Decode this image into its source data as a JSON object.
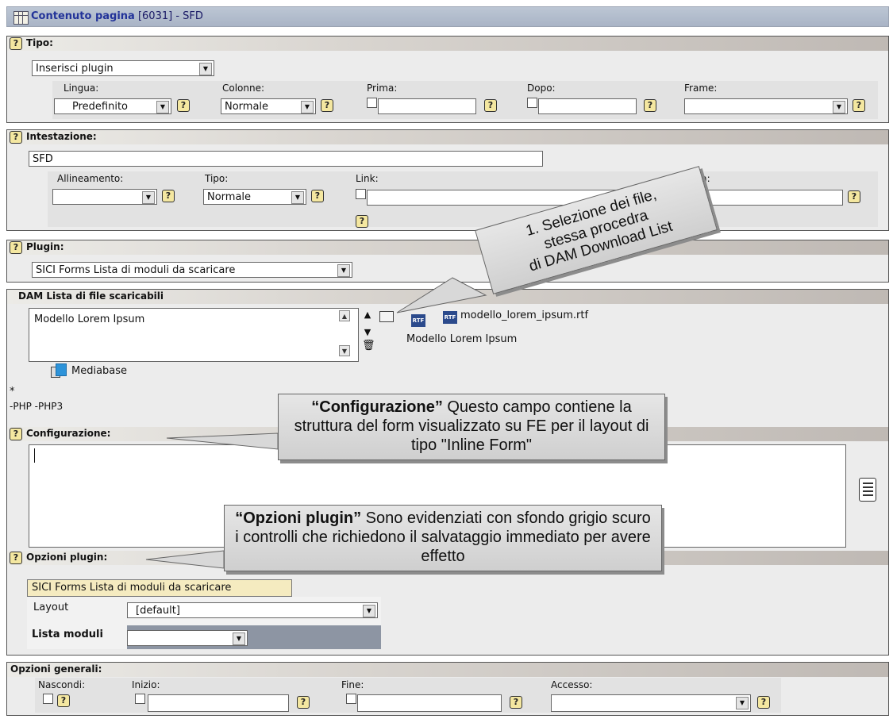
{
  "header": {
    "title_bold": "Contenuto pagina",
    "title_rest": "[6031] - SFD"
  },
  "tipo": {
    "label": "Tipo:",
    "type_value": "Inserisci plugin",
    "lingua_label": "Lingua:",
    "lingua_value": "Predefinito",
    "colonne_label": "Colonne:",
    "colonne_value": "Normale",
    "prima_label": "Prima:",
    "dopo_label": "Dopo:",
    "frame_label": "Frame:"
  },
  "intestazione": {
    "label": "Intestazione:",
    "value": "SFD",
    "allineamento_label": "Allineamento:",
    "tipo_label": "Tipo:",
    "tipo_value": "Normale",
    "link_label": "Link:",
    "data_label": "Data:"
  },
  "plugin": {
    "label": "Plugin:",
    "value": "SICI Forms Lista di moduli da scaricare"
  },
  "dam": {
    "label": "DAM Lista di file scaricabili",
    "list_item": "Modello Lorem Ipsum",
    "file_name": "modello_lorem_ipsum.rtf",
    "file_title": "Modello Lorem Ipsum",
    "rtf_badge": "RTF",
    "mediabase": "Mediabase",
    "star": "*",
    "php_note": "-PHP -PHP3"
  },
  "configurazione": {
    "label": "Configurazione:",
    "value": ""
  },
  "opzioni_plugin": {
    "label": "Opzioni plugin:",
    "tab_label": "SICI Forms Lista di moduli da scaricare",
    "layout_label": "Layout",
    "layout_value": "[default]",
    "lista_label": "Lista moduli",
    "lista_value": ""
  },
  "generali": {
    "label": "Opzioni generali:",
    "nascondi_label": "Nascondi:",
    "inizio_label": "Inizio:",
    "fine_label": "Fine:",
    "accesso_label": "Accesso:"
  },
  "help": {
    "glyph": "?"
  },
  "callouts": {
    "file_lines": [
      "1. Selezione dei file,",
      "stessa procedra",
      "di DAM Download List"
    ],
    "config_bold": "“Configurazione”",
    "config_rest": " Questo campo contiene la struttura del form visualizzato su FE per il layout di tipo \"Inline Form\"",
    "opzioni_bold": "“Opzioni plugin”",
    "opzioni_rest": " Sono evidenziati con sfondo grigio scuro i controlli che richiedono il salvataggio immediato per avere effetto"
  },
  "icons": [
    "table-icon",
    "help-icon",
    "chevron-down-icon",
    "arrow-up-icon",
    "arrow-down-icon",
    "folder-icon",
    "trash-icon",
    "rtf-file-icon",
    "mediabase-icon",
    "wizard-icon"
  ],
  "colors": {
    "title_bar": "#a9b4c6",
    "title_text": "#223399",
    "section_bg": "#ececec",
    "help_icon": "#f4e7a0",
    "dark_control": "#8d95a3"
  }
}
